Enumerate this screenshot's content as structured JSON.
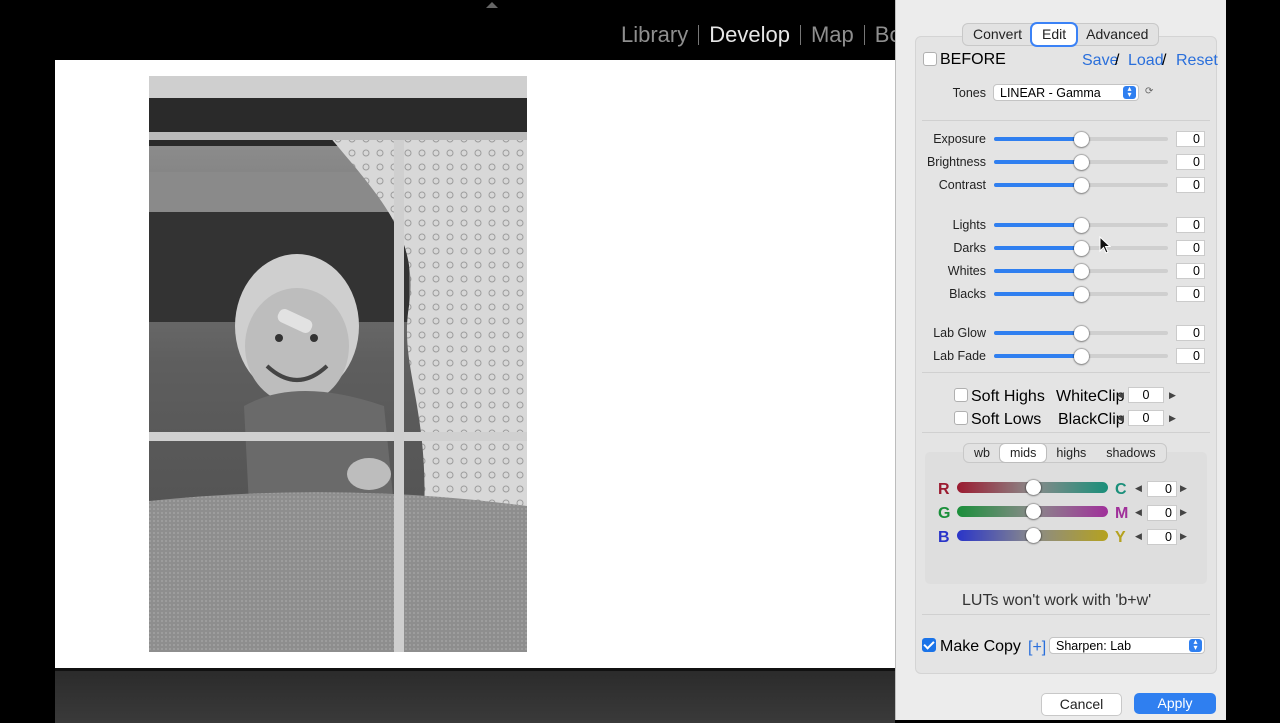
{
  "lightroom": {
    "modules": [
      "Library",
      "Develop",
      "Map",
      "Bo"
    ],
    "active_module": "Develop"
  },
  "dialog": {
    "tabs": [
      {
        "label": "Convert",
        "active": false
      },
      {
        "label": "Edit",
        "active": true
      },
      {
        "label": "Advanced",
        "active": false
      }
    ],
    "before": {
      "label": "BEFORE",
      "checked": false
    },
    "preset_links": {
      "save": "Save",
      "load": "Load",
      "reset": "Reset",
      "separator": "/"
    },
    "tones": {
      "label": "Tones",
      "value": "LINEAR - Gamma",
      "reset_glyph": "⟳"
    },
    "sliders_basic": [
      {
        "label": "Exposure",
        "value": "0",
        "level": 0.5
      },
      {
        "label": "Brightness",
        "value": "0",
        "level": 0.5
      },
      {
        "label": "Contrast",
        "value": "0",
        "level": 0.5
      }
    ],
    "sliders_tone": [
      {
        "label": "Lights",
        "value": "0",
        "level": 0.5
      },
      {
        "label": "Darks",
        "value": "0",
        "level": 0.5
      },
      {
        "label": "Whites",
        "value": "0",
        "level": 0.5
      },
      {
        "label": "Blacks",
        "value": "0",
        "level": 0.5
      }
    ],
    "sliders_lab": [
      {
        "label": "Lab Glow",
        "value": "0",
        "level": 0.5
      },
      {
        "label": "Lab Fade",
        "value": "0",
        "level": 0.5
      }
    ],
    "soft_highs": {
      "label": "Soft Highs",
      "checked": false
    },
    "soft_lows": {
      "label": "Soft Lows",
      "checked": false
    },
    "white_clip": {
      "label": "WhiteClip",
      "value": "0"
    },
    "black_clip": {
      "label": "BlackClip",
      "value": "0"
    },
    "color_tabs": [
      {
        "label": "wb",
        "active": false
      },
      {
        "label": "mids",
        "active": true
      },
      {
        "label": "highs",
        "active": false
      },
      {
        "label": "shadows",
        "active": false
      }
    ],
    "color_sliders": [
      {
        "left": "R",
        "right": "C",
        "value": "0",
        "level": 0.5,
        "left_color": "#9b1b30",
        "right_color": "#1a8f7a"
      },
      {
        "left": "G",
        "right": "M",
        "value": "0",
        "level": 0.5,
        "left_color": "#1a8f3a",
        "right_color": "#a0309a"
      },
      {
        "left": "B",
        "right": "Y",
        "value": "0",
        "level": 0.5,
        "left_color": "#2a35c9",
        "right_color": "#b5a21f"
      }
    ],
    "lut_note": "LUTs won't work with 'b+w'",
    "make_copy": {
      "label": "Make Copy",
      "checked": true
    },
    "plus_link": "[+]",
    "sharpen": {
      "value": "Sharpen: Lab"
    },
    "cancel_label": "Cancel",
    "apply_label": "Apply",
    "accent_color": "#2f7ff0"
  }
}
